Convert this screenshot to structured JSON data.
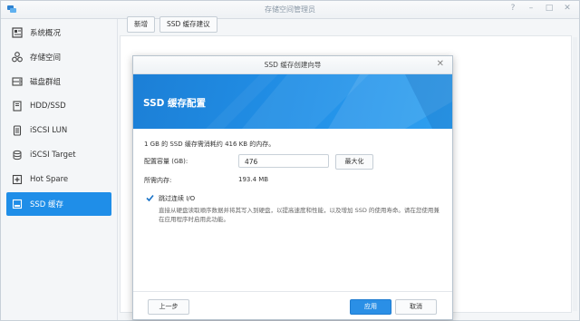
{
  "window": {
    "title": "存储空间管理员"
  },
  "colors": {
    "accent": "#1f8ee8",
    "banner": "#1c7fd6",
    "primary_button": "#2a8fe6"
  },
  "sidebar": {
    "items": [
      {
        "label": "系统概况",
        "icon": "dashboard-icon"
      },
      {
        "label": "存储空间",
        "icon": "storage-pool-icon"
      },
      {
        "label": "磁盘群组",
        "icon": "disk-group-icon"
      },
      {
        "label": "HDD/SSD",
        "icon": "hdd-icon"
      },
      {
        "label": "iSCSI LUN",
        "icon": "lun-icon"
      },
      {
        "label": "iSCSI Target",
        "icon": "target-icon"
      },
      {
        "label": "Hot Spare",
        "icon": "hot-spare-icon"
      },
      {
        "label": "SSD 缓存",
        "icon": "ssd-cache-icon",
        "active": true
      }
    ]
  },
  "toolbar": {
    "new_label": "新增",
    "advisor_label": "SSD 缓存建议"
  },
  "dialog": {
    "title": "SSD 缓存创建向导",
    "banner_title": "SSD 缓存配置",
    "memory_note": "1 GB 的 SSD 缓存需消耗约 416 KB 的内存。",
    "capacity_label": "配置容量 (GB):",
    "capacity_value": "476",
    "max_button": "最大化",
    "required_memory_label": "所需内存:",
    "required_memory_value": "193.4 MB",
    "skip_io_checked": true,
    "skip_io_label": "跳过连续 I/O",
    "skip_io_desc": "直接从硬盘读取顺序数据并将其写入到硬盘，以提高速度和性能，以及增加 SSD 的使用寿命。请在您使用兼在应用程序时启用此功能。",
    "back_button": "上一步",
    "apply_button": "应用",
    "cancel_button": "取消"
  }
}
